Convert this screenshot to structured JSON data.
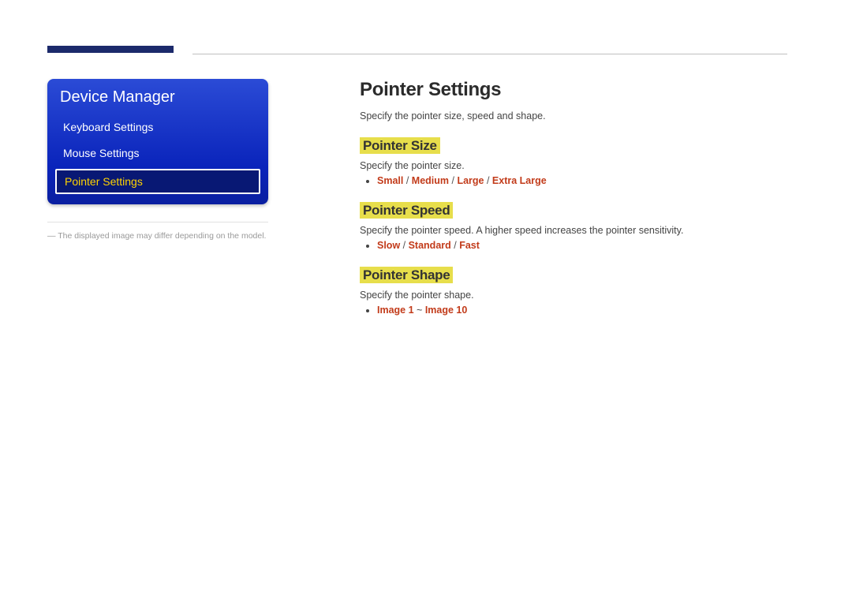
{
  "sidebar": {
    "title": "Device Manager",
    "items": [
      {
        "label": "Keyboard Settings",
        "selected": false
      },
      {
        "label": "Mouse Settings",
        "selected": false
      },
      {
        "label": "Pointer Settings",
        "selected": true
      }
    ],
    "footnote": "The displayed image may differ depending on the model."
  },
  "main": {
    "title": "Pointer Settings",
    "intro": "Specify the pointer size, speed and shape.",
    "sections": [
      {
        "heading": "Pointer Size",
        "desc": "Specify the pointer size.",
        "options": [
          "Small",
          "Medium",
          "Large",
          "Extra Large"
        ],
        "separator": " / "
      },
      {
        "heading": "Pointer Speed",
        "desc": "Specify the pointer speed. A higher speed increases the pointer sensitivity.",
        "options": [
          "Slow",
          "Standard",
          "Fast"
        ],
        "separator": " / "
      },
      {
        "heading": "Pointer Shape",
        "desc": "Specify the pointer shape.",
        "range": {
          "from": "Image 1",
          "to": "Image 10"
        }
      }
    ]
  }
}
